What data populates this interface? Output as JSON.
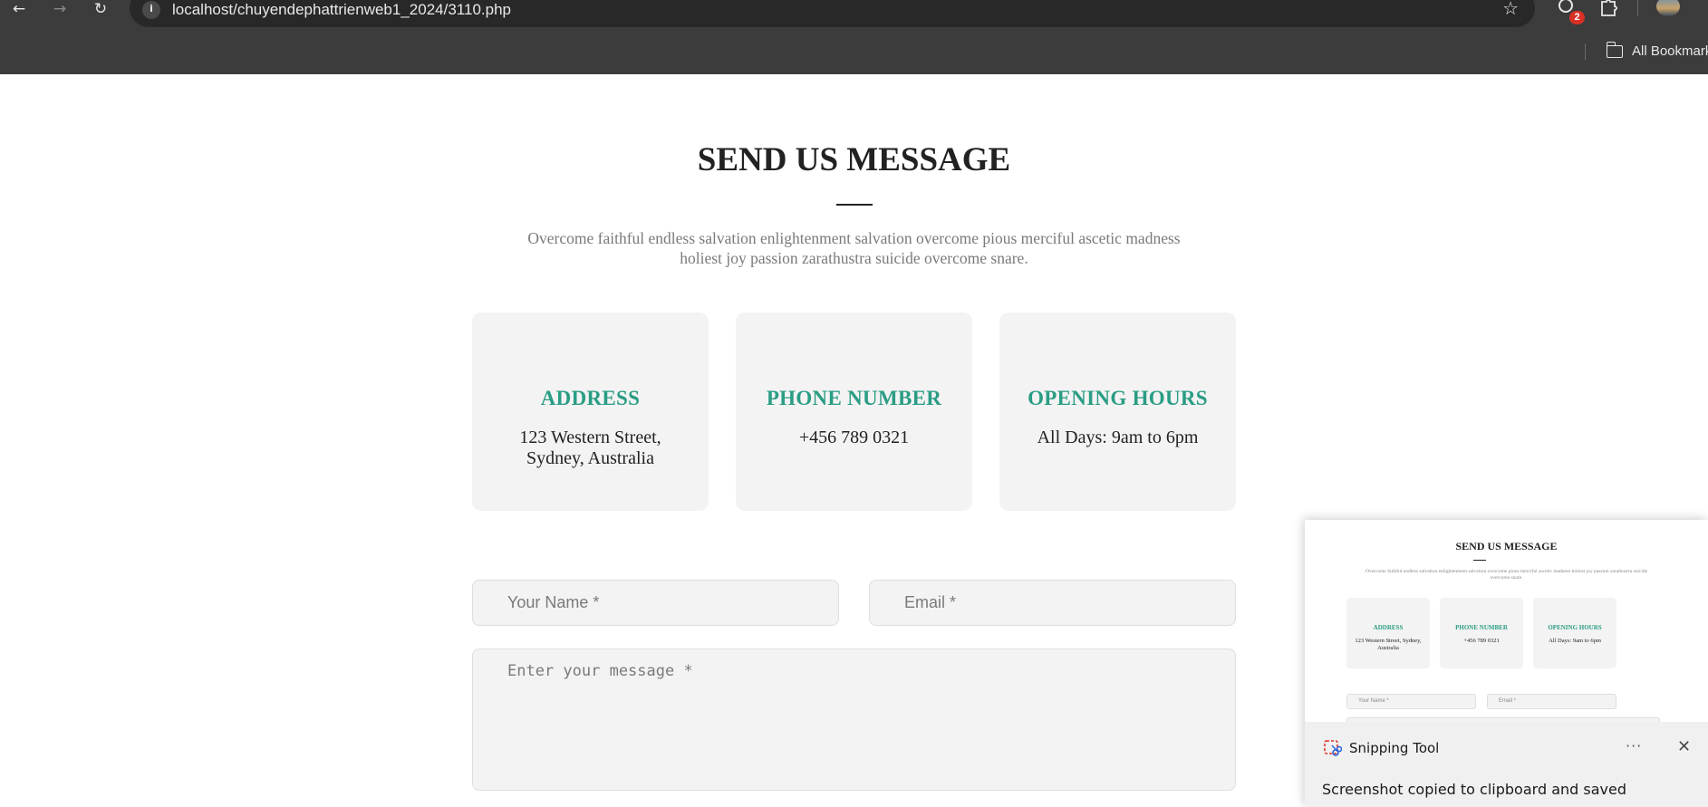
{
  "browser": {
    "url": "localhost/chuyendephattrienweb1_2024/3110.php",
    "extension_badge": "2",
    "bookmarks_label": "All Bookmarks",
    "icons": {
      "back": "←",
      "forward": "→",
      "reload": "↻",
      "site_info": "i",
      "star": "☆",
      "extensions": "⧉"
    }
  },
  "page": {
    "title": "SEND US MESSAGE",
    "intro": "Overcome faithful endless salvation enlightenment salvation overcome pious merciful ascetic madness holiest joy passion zarathustra suicide overcome snare.",
    "cards": [
      {
        "heading": "ADDRESS",
        "value": "123 Western Street, Sydney, Australia"
      },
      {
        "heading": "PHONE NUMBER",
        "value": "+456 789 0321"
      },
      {
        "heading": "OPENING HOURS",
        "value": "All Days: 9am to 6pm"
      }
    ],
    "form": {
      "name_placeholder": "Your Name *",
      "email_placeholder": "Email *",
      "message_placeholder": "Enter your message *"
    },
    "colors": {
      "accent": "#2a9d84",
      "card_bg": "#f3f3f3",
      "title": "#222222",
      "muted_text": "#7a7a7a"
    }
  },
  "snipping_tool": {
    "app_name": "Snipping Tool",
    "more_icon": "···",
    "close_icon": "✕",
    "message": "Screenshot copied to clipboard and saved",
    "thumbnail": {
      "title": "SEND US MESSAGE",
      "intro": "Overcome faithful endless salvation enlightenment salvation overcome pious merciful ascetic madness holiest joy passion zarathustra suicide overcome snare.",
      "cards": [
        {
          "heading": "ADDRESS",
          "value": "123 Western Street, Sydney, Australia"
        },
        {
          "heading": "PHONE NUMBER",
          "value": "+456 789 0321"
        },
        {
          "heading": "OPENING HOURS",
          "value": "All Days: 9am to 6pm"
        }
      ],
      "name_placeholder": "Your Name *",
      "email_placeholder": "Email *"
    }
  }
}
